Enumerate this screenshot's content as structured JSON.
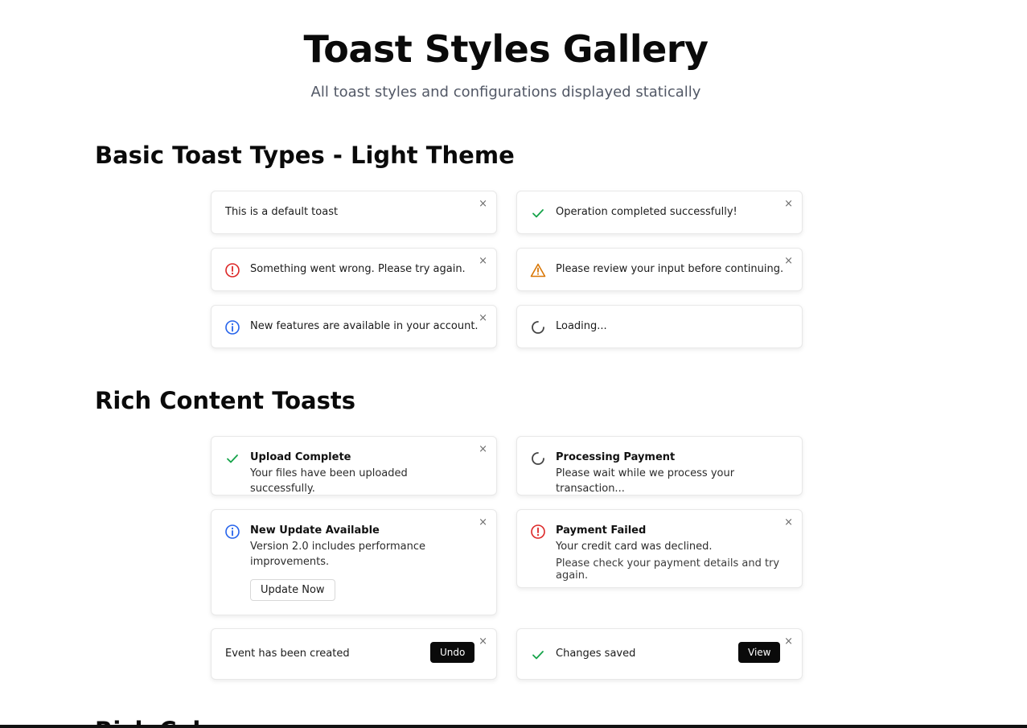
{
  "header": {
    "title": "Toast Styles Gallery",
    "subtitle": "All toast styles and configurations displayed statically"
  },
  "sections": {
    "basic": {
      "heading": "Basic Toast Types - Light Theme"
    },
    "rich": {
      "heading": "Rich Content Toasts"
    },
    "next": {
      "heading": "Rich Colors"
    }
  },
  "basic_toasts": {
    "default": {
      "message": "This is a default toast",
      "close": "×"
    },
    "success": {
      "message": "Operation completed successfully!",
      "close": "×",
      "icon": "check-icon"
    },
    "error": {
      "message": "Something went wrong. Please try again.",
      "close": "×",
      "icon": "error-circle-icon"
    },
    "warning": {
      "message": "Please review your input before continuing.",
      "close": "×",
      "icon": "warning-triangle-icon"
    },
    "info": {
      "message": "New features are available in your account.",
      "close": "×",
      "icon": "info-circle-icon"
    },
    "loading": {
      "message": "Loading...",
      "icon": "spinner-icon"
    }
  },
  "rich_toasts": {
    "upload": {
      "title": "Upload Complete",
      "description": "Your files have been uploaded successfully.",
      "close": "×",
      "icon": "check-icon"
    },
    "payment_processing": {
      "title": "Processing Payment",
      "description": "Please wait while we process your transaction...",
      "icon": "spinner-icon"
    },
    "update": {
      "title": "New Update Available",
      "description": "Version 2.0 includes performance improvements.",
      "button": "Update Now",
      "close": "×",
      "icon": "info-circle-icon"
    },
    "payment_failed": {
      "title": "Payment Failed",
      "description": "Your credit card was declined.",
      "detail": "Please check your payment details and try again.",
      "close": "×",
      "icon": "error-circle-icon"
    },
    "event": {
      "message": "Event has been created",
      "action": "Undo",
      "close": "×"
    },
    "changes": {
      "message": "Changes saved",
      "action": "View",
      "close": "×",
      "icon": "check-icon"
    }
  },
  "colors": {
    "success": "#16a34a",
    "error": "#dc2626",
    "warning": "#d97706",
    "info": "#2563eb",
    "loading": "#444444"
  }
}
